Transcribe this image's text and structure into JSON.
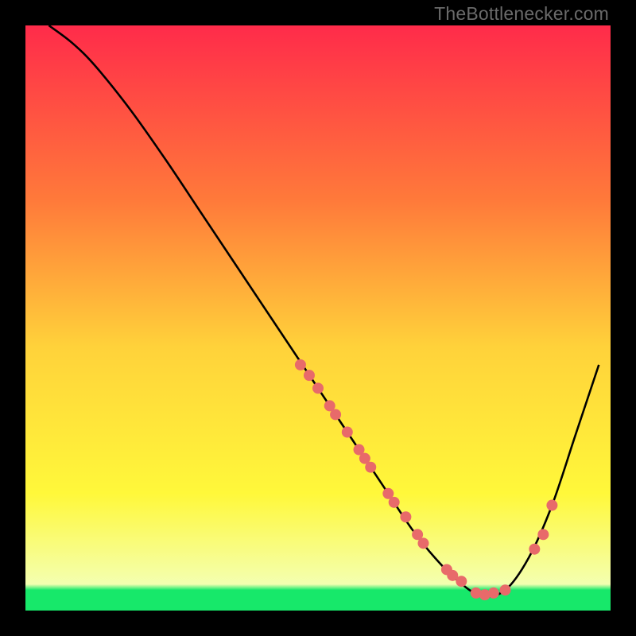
{
  "watermark": "TheBottlenecker.com",
  "colors": {
    "bg": "#000000",
    "grad_top": "#ff2b4a",
    "grad_mid1": "#ff7a3a",
    "grad_mid2": "#ffd23a",
    "grad_mid3": "#fff83a",
    "grad_band": "#f4ffb0",
    "grad_bottom": "#17e86a",
    "curve": "#000000",
    "dot": "#e86a6a"
  },
  "chart_data": {
    "type": "line",
    "title": "",
    "xlabel": "",
    "ylabel": "",
    "xlim": [
      0,
      100
    ],
    "ylim": [
      0,
      100
    ],
    "series": [
      {
        "name": "curve",
        "x": [
          4,
          8,
          12,
          18,
          24,
          30,
          36,
          42,
          48,
          54,
          58,
          62,
          66,
          70,
          74,
          78,
          82,
          86,
          90,
          94,
          98
        ],
        "y": [
          100,
          97,
          93,
          85.5,
          77,
          68,
          59,
          50,
          41,
          32,
          26,
          20,
          14,
          9,
          5,
          2.5,
          3.5,
          9,
          18,
          30,
          42
        ]
      }
    ],
    "dots": {
      "name": "highlight-points",
      "x": [
        47,
        48.5,
        50,
        52,
        53,
        55,
        57,
        58,
        59,
        62,
        63,
        65,
        67,
        68,
        72,
        73,
        74.5,
        77,
        78.5,
        80,
        82,
        87,
        88.5,
        90
      ],
      "y": [
        42,
        40.2,
        38,
        35,
        33.5,
        30.5,
        27.5,
        26,
        24.5,
        20,
        18.5,
        16,
        13,
        11.5,
        7,
        6,
        5,
        3,
        2.7,
        3,
        3.5,
        10.5,
        13,
        18
      ]
    }
  }
}
